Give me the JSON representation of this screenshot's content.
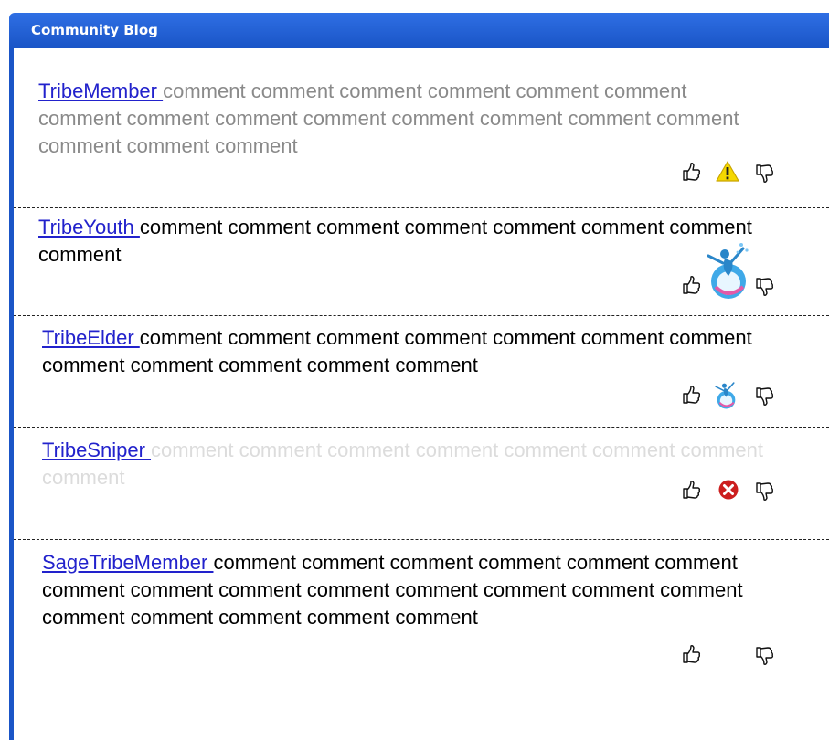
{
  "header": {
    "title": "Community Blog"
  },
  "icons": {
    "thumbs_up": "thumbs-up-icon",
    "thumbs_down": "thumbs-down-icon",
    "warning": "warning-icon",
    "tribe_badge": "tribe-badge-icon",
    "error": "error-icon"
  },
  "colors": {
    "header_bg": "#1a55c7",
    "link": "#2222cc",
    "warning": "#f5d800",
    "error": "#cc1f1f"
  },
  "posts": [
    {
      "author": "TribeMember ",
      "comment": "comment comment comment comment comment comment comment comment comment comment comment comment comment comment comment comment comment",
      "badge": "warning-icon"
    },
    {
      "author": "TribeYouth ",
      "comment": "comment comment comment comment comment comment comment comment",
      "badge": "tribe-badge-icon"
    },
    {
      "author": "TribeElder ",
      "comment": "comment comment comment comment comment comment comment comment comment comment comment comment",
      "badge": "tribe-badge-icon"
    },
    {
      "author": "TribeSniper ",
      "comment": "comment comment comment comment comment comment comment comment",
      "badge": "error-icon"
    },
    {
      "author": "SageTribeMember ",
      "comment": "comment comment comment comment comment comment comment comment comment comment comment comment comment comment comment comment comment comment comment",
      "badge": ""
    }
  ]
}
